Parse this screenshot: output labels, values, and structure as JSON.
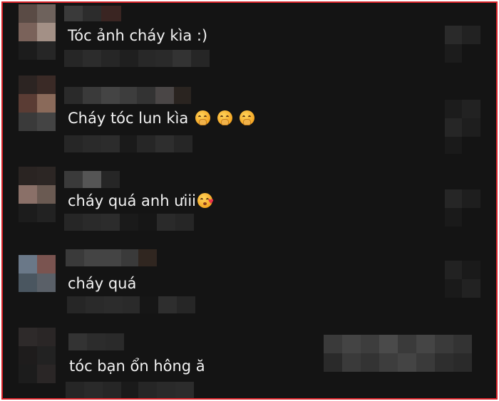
{
  "comments": [
    {
      "text": "Tóc ảnh cháy kìa :)",
      "emojis": []
    },
    {
      "text": "Cháy tóc lun kìa",
      "emojis": [
        "face-with-hand-over-mouth",
        "face-with-hand-over-mouth",
        "face-with-hand-over-mouth"
      ]
    },
    {
      "text": "cháy quá anh ưiii",
      "emojis": [
        "face-blowing-a-kiss"
      ]
    },
    {
      "text": "cháy quá",
      "emojis": []
    },
    {
      "text": "tóc bạn ổn hông ă",
      "emojis": []
    }
  ],
  "colors": {
    "background": "#141414",
    "text": "#f2f2f2",
    "frame_border": "#d9252b"
  }
}
